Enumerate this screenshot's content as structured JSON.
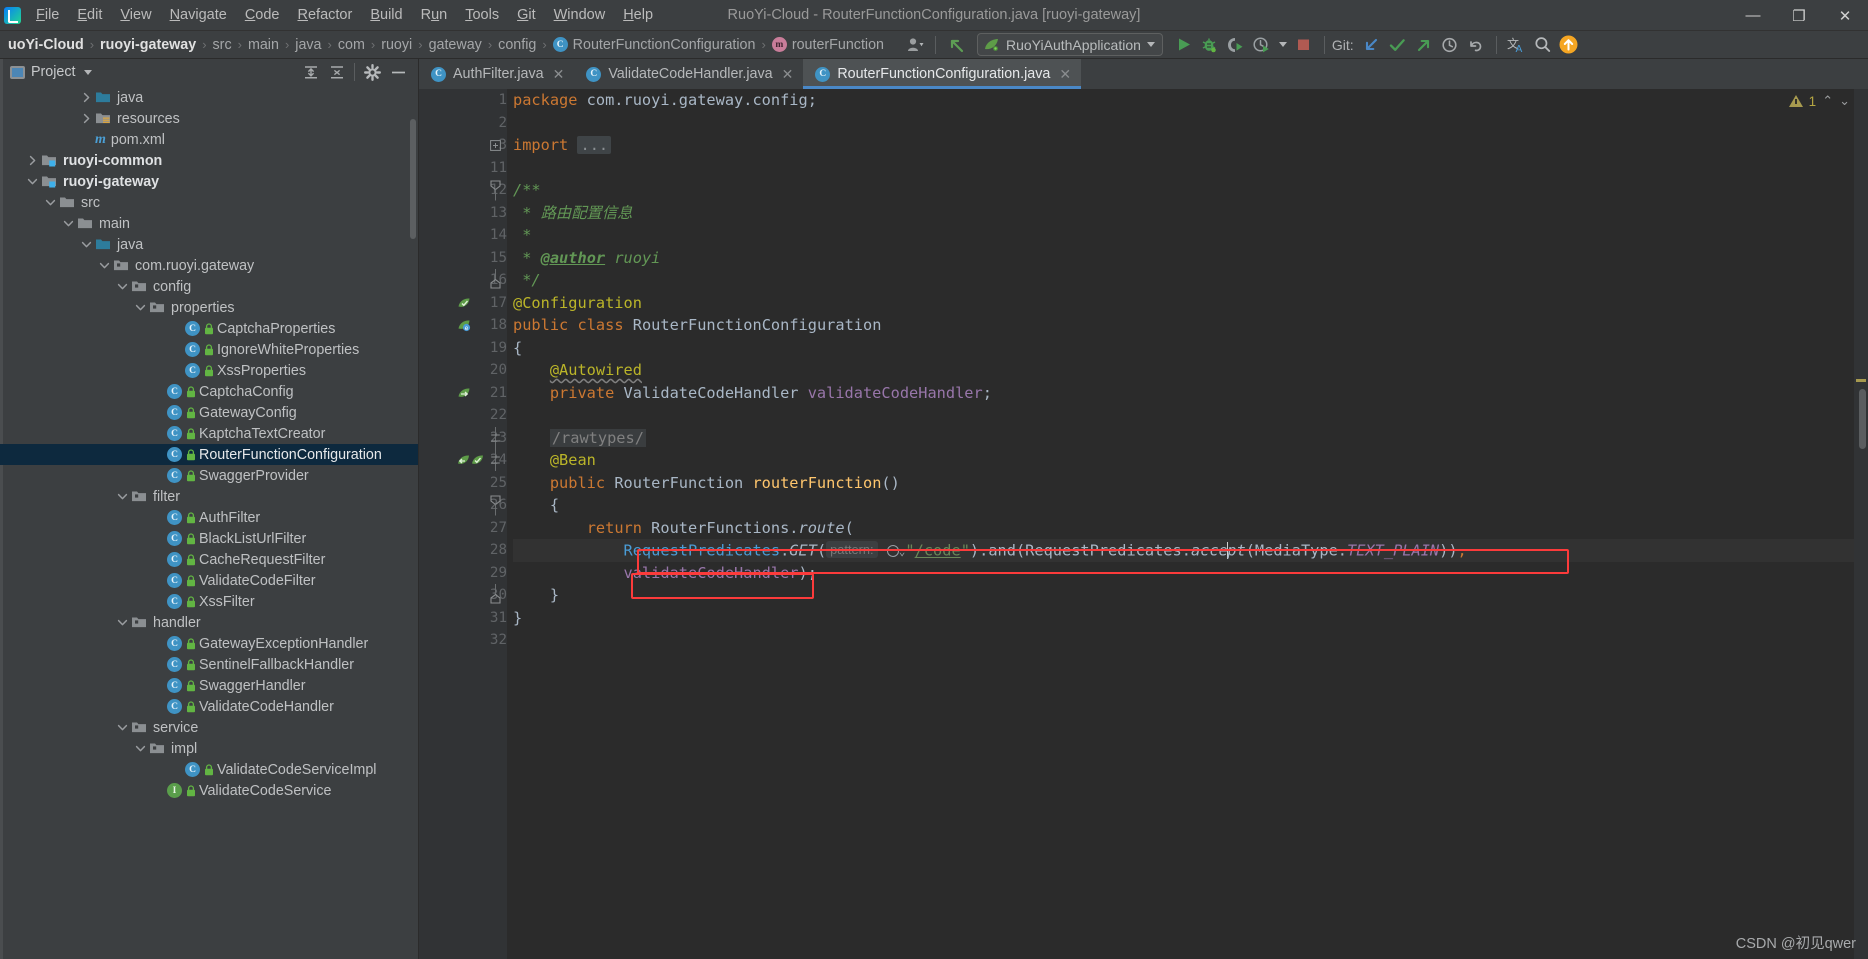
{
  "window": {
    "title": "RuoYi-Cloud - RouterFunctionConfiguration.java [ruoyi-gateway]",
    "minimize": "—",
    "maximize": "❐",
    "close": "✕"
  },
  "menubar": {
    "items": [
      {
        "label": "File",
        "mnemonic": "F"
      },
      {
        "label": "Edit",
        "mnemonic": "E"
      },
      {
        "label": "View",
        "mnemonic": "V"
      },
      {
        "label": "Navigate",
        "mnemonic": "N"
      },
      {
        "label": "Code",
        "mnemonic": "C"
      },
      {
        "label": "Refactor",
        "mnemonic": "R"
      },
      {
        "label": "Build",
        "mnemonic": "B"
      },
      {
        "label": "Run",
        "mnemonic": "u"
      },
      {
        "label": "Tools",
        "mnemonic": "T"
      },
      {
        "label": "Git",
        "mnemonic": "G"
      },
      {
        "label": "Window",
        "mnemonic": "W"
      },
      {
        "label": "Help",
        "mnemonic": "H"
      }
    ]
  },
  "navbar": {
    "crumbs": [
      {
        "label": "uoYi-Cloud",
        "style": "bold"
      },
      {
        "label": "ruoyi-gateway",
        "style": "bold"
      },
      {
        "label": "src",
        "style": "dim"
      },
      {
        "label": "main",
        "style": "dim"
      },
      {
        "label": "java",
        "style": "dim"
      },
      {
        "label": "com",
        "style": "dim"
      },
      {
        "label": "ruoyi",
        "style": "dim"
      },
      {
        "label": "gateway",
        "style": "dim"
      },
      {
        "label": "config",
        "style": "dim"
      },
      {
        "label": "RouterFunctionConfiguration",
        "style": "dim",
        "icon": "class-badge",
        "icon_letter": "C"
      },
      {
        "label": "routerFunction",
        "style": "dim",
        "icon": "method-badge",
        "icon_letter": "m"
      }
    ],
    "run_configuration": "RuoYiAuthApplication",
    "git_label": "Git:",
    "icons": [
      "user-avatar-icon",
      "back-arrow-icon",
      "run-icon",
      "debug-icon",
      "run-coverage-icon",
      "profiler-icon",
      "stop-icon",
      "git-update-icon",
      "git-commit-icon",
      "git-push-icon",
      "git-history-icon",
      "undo-icon",
      "translate-icon",
      "search-icon",
      "update-available-icon"
    ]
  },
  "project_panel": {
    "title": "Project",
    "actions": [
      "expand-all-icon",
      "collapse-all-icon",
      "settings-gear-icon",
      "hide-panel-icon"
    ],
    "tree": [
      {
        "label": "java",
        "indent": 4,
        "arrow": "right",
        "icon": "folder-source"
      },
      {
        "label": "resources",
        "indent": 4,
        "arrow": "right",
        "icon": "folder-resources"
      },
      {
        "label": "pom.xml",
        "indent": 4,
        "arrow": "none",
        "icon": "maven"
      },
      {
        "label": "ruoyi-common",
        "indent": 1,
        "arrow": "right",
        "icon": "folder-module",
        "bold": true
      },
      {
        "label": "ruoyi-gateway",
        "indent": 1,
        "arrow": "down",
        "icon": "folder-module",
        "bold": true
      },
      {
        "label": "src",
        "indent": 2,
        "arrow": "down",
        "icon": "folder"
      },
      {
        "label": "main",
        "indent": 3,
        "arrow": "down",
        "icon": "folder"
      },
      {
        "label": "java",
        "indent": 4,
        "arrow": "down",
        "icon": "folder-source"
      },
      {
        "label": "com.ruoyi.gateway",
        "indent": 5,
        "arrow": "down",
        "icon": "package"
      },
      {
        "label": "config",
        "indent": 6,
        "arrow": "down",
        "icon": "package"
      },
      {
        "label": "properties",
        "indent": 7,
        "arrow": "down",
        "icon": "package"
      },
      {
        "label": "CaptchaProperties",
        "indent": 9,
        "arrow": "none",
        "icon": "class"
      },
      {
        "label": "IgnoreWhiteProperties",
        "indent": 9,
        "arrow": "none",
        "icon": "class"
      },
      {
        "label": "XssProperties",
        "indent": 9,
        "arrow": "none",
        "icon": "class"
      },
      {
        "label": "CaptchaConfig",
        "indent": 8,
        "arrow": "none",
        "icon": "class"
      },
      {
        "label": "GatewayConfig",
        "indent": 8,
        "arrow": "none",
        "icon": "class"
      },
      {
        "label": "KaptchaTextCreator",
        "indent": 8,
        "arrow": "none",
        "icon": "class"
      },
      {
        "label": "RouterFunctionConfiguration",
        "indent": 8,
        "arrow": "none",
        "icon": "class",
        "selected": true
      },
      {
        "label": "SwaggerProvider",
        "indent": 8,
        "arrow": "none",
        "icon": "class"
      },
      {
        "label": "filter",
        "indent": 6,
        "arrow": "down",
        "icon": "package"
      },
      {
        "label": "AuthFilter",
        "indent": 8,
        "arrow": "none",
        "icon": "class"
      },
      {
        "label": "BlackListUrlFilter",
        "indent": 8,
        "arrow": "none",
        "icon": "class"
      },
      {
        "label": "CacheRequestFilter",
        "indent": 8,
        "arrow": "none",
        "icon": "class"
      },
      {
        "label": "ValidateCodeFilter",
        "indent": 8,
        "arrow": "none",
        "icon": "class"
      },
      {
        "label": "XssFilter",
        "indent": 8,
        "arrow": "none",
        "icon": "class"
      },
      {
        "label": "handler",
        "indent": 6,
        "arrow": "down",
        "icon": "package"
      },
      {
        "label": "GatewayExceptionHandler",
        "indent": 8,
        "arrow": "none",
        "icon": "class"
      },
      {
        "label": "SentinelFallbackHandler",
        "indent": 8,
        "arrow": "none",
        "icon": "class"
      },
      {
        "label": "SwaggerHandler",
        "indent": 8,
        "arrow": "none",
        "icon": "class"
      },
      {
        "label": "ValidateCodeHandler",
        "indent": 8,
        "arrow": "none",
        "icon": "class"
      },
      {
        "label": "service",
        "indent": 6,
        "arrow": "down",
        "icon": "package"
      },
      {
        "label": "impl",
        "indent": 7,
        "arrow": "down",
        "icon": "package"
      },
      {
        "label": "ValidateCodeServiceImpl",
        "indent": 9,
        "arrow": "none",
        "icon": "class"
      },
      {
        "label": "ValidateCodeService",
        "indent": 8,
        "arrow": "none",
        "icon": "interface"
      }
    ]
  },
  "editor": {
    "tabs": [
      {
        "label": "AuthFilter.java",
        "active": false,
        "close": "✕"
      },
      {
        "label": "ValidateCodeHandler.java",
        "active": false,
        "close": "✕"
      },
      {
        "label": "RouterFunctionConfiguration.java",
        "active": true,
        "close": "✕"
      }
    ],
    "inspection": {
      "warning_count": "1",
      "up": "⌃",
      "down": "⌄"
    },
    "line_numbers": [
      "1",
      "2",
      "3",
      "11",
      "12",
      "13",
      "14",
      "15",
      "16",
      "17",
      "18",
      "19",
      "20",
      "21",
      "22",
      "23",
      "24",
      "25",
      "26",
      "27",
      "28",
      "29",
      "30",
      "31",
      "32"
    ],
    "code_lines": [
      {
        "n": "1",
        "text": "package com.ruoyi.gateway.config;"
      },
      {
        "n": "2",
        "text": ""
      },
      {
        "n": "3",
        "text": "import ..."
      },
      {
        "n": "11",
        "text": ""
      },
      {
        "n": "12",
        "text": "/**"
      },
      {
        "n": "13",
        "text": " * 路由配置信息"
      },
      {
        "n": "14",
        "text": " *"
      },
      {
        "n": "15",
        "text": " * @author ruoyi"
      },
      {
        "n": "16",
        "text": " */"
      },
      {
        "n": "17",
        "text": "@Configuration"
      },
      {
        "n": "18",
        "text": "public class RouterFunctionConfiguration"
      },
      {
        "n": "19",
        "text": "{"
      },
      {
        "n": "20",
        "text": "    @Autowired"
      },
      {
        "n": "21",
        "text": "    private ValidateCodeHandler validateCodeHandler;"
      },
      {
        "n": "22",
        "text": ""
      },
      {
        "n": "23",
        "text": "    /rawtypes/"
      },
      {
        "n": "24",
        "text": "    @Bean"
      },
      {
        "n": "25",
        "text": "    public RouterFunction routerFunction()"
      },
      {
        "n": "26",
        "text": "    {"
      },
      {
        "n": "27",
        "text": "        return RouterFunctions.route("
      },
      {
        "n": "28",
        "text": "            RequestPredicates.GET( pattern: \"/code\").and(RequestPredicates.accept(MediaType.TEXT_PLAIN)),"
      },
      {
        "n": "29",
        "text": "            validateCodeHandler);"
      },
      {
        "n": "30",
        "text": "    }"
      },
      {
        "n": "31",
        "text": "}"
      },
      {
        "n": "32",
        "text": ""
      }
    ],
    "param_hint": "pattern:",
    "highlight_boxes": 2
  },
  "watermark": "CSDN @初见qwer",
  "colors": {
    "accent_blue": "#4a88c7",
    "selection": "#0d293e",
    "highlight_red": "#fc3b3b",
    "keyword": "#cc7832",
    "string": "#6a8759",
    "comment": "#629755",
    "annotation": "#bbb529",
    "field": "#9876aa",
    "method": "#ffc66d",
    "editor_bg": "#2b2b2b",
    "panel_bg": "#3c3f41"
  }
}
